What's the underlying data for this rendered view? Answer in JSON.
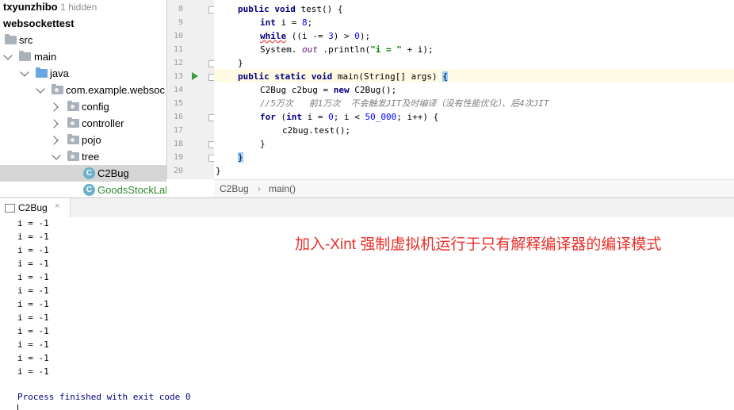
{
  "project_tree": {
    "items": [
      {
        "label": "txyunzhibo",
        "extra": "1 hidden"
      },
      {
        "label": "websockettest"
      },
      {
        "label": "src"
      },
      {
        "label": "main"
      },
      {
        "label": "java"
      },
      {
        "label": "com.example.websoc"
      },
      {
        "label": "config"
      },
      {
        "label": "controller"
      },
      {
        "label": "pojo"
      },
      {
        "label": "tree"
      },
      {
        "label": "C2Bug"
      },
      {
        "label": "GoodsStockLab"
      }
    ],
    "class_icon_letter": "C"
  },
  "editor": {
    "line_numbers": [
      "8",
      "9",
      "10",
      "11",
      "12",
      "13",
      "14",
      "15",
      "16",
      "17",
      "18",
      "19",
      "20"
    ],
    "lines": [
      {
        "t": [
          {
            "c": "kw",
            "s": "public void "
          },
          {
            "c": "",
            "s": "test() {"
          }
        ]
      },
      {
        "t": [
          {
            "c": "kw",
            "s": "int "
          },
          {
            "c": "",
            "s": "i = "
          },
          {
            "c": "num",
            "s": "8"
          },
          {
            "c": "",
            "s": ";"
          }
        ]
      },
      {
        "t": [
          {
            "c": "kw",
            "s": "while"
          },
          {
            "c": "",
            "s": " ((i -= "
          },
          {
            "c": "num",
            "s": "3"
          },
          {
            "c": "",
            "s": ") > "
          },
          {
            "c": "num",
            "s": "0"
          },
          {
            "c": "",
            "s": ");"
          }
        ]
      },
      {
        "t": [
          {
            "c": "",
            "s": "System. "
          },
          {
            "c": "fld",
            "s": "out"
          },
          {
            "c": "",
            "s": " .println("
          },
          {
            "c": "str",
            "s": "\"i = \""
          },
          {
            "c": "",
            "s": " + i);"
          }
        ]
      },
      {
        "t": [
          {
            "c": "",
            "s": "}"
          }
        ]
      },
      {
        "t": [
          {
            "c": "kw",
            "s": "public static void "
          },
          {
            "c": "",
            "s": "main(String[] args) "
          },
          {
            "c": "brace",
            "s": "{"
          }
        ]
      },
      {
        "t": [
          {
            "c": "",
            "s": "C2Bug c2bug = "
          },
          {
            "c": "kw",
            "s": "new "
          },
          {
            "c": "",
            "s": "C2Bug();"
          }
        ]
      },
      {
        "t": [
          {
            "c": "cmt",
            "s": "//5万次   前1万次  不会触发JIT及时编译（没有性能优化）、后4次JIT"
          }
        ]
      },
      {
        "t": [
          {
            "c": "kw",
            "s": "for "
          },
          {
            "c": "",
            "s": "("
          },
          {
            "c": "kw",
            "s": "int "
          },
          {
            "c": "",
            "s": "i = "
          },
          {
            "c": "num",
            "s": "0"
          },
          {
            "c": "",
            "s": "; i < "
          },
          {
            "c": "num",
            "s": "50_000"
          },
          {
            "c": "",
            "s": "; i++) {"
          }
        ]
      },
      {
        "t": [
          {
            "c": "",
            "s": "c2bug.test();"
          }
        ]
      },
      {
        "t": [
          {
            "c": "",
            "s": "}"
          }
        ]
      },
      {
        "t": [
          {
            "c": "brace",
            "s": "}"
          }
        ]
      },
      {
        "t": [
          {
            "c": "",
            "s": "}"
          }
        ]
      }
    ],
    "breadcrumb": {
      "class": "C2Bug",
      "sep": "›",
      "method": "main()"
    }
  },
  "run_panel": {
    "tab_label": "C2Bug",
    "tab_close": "×",
    "output_lines": [
      "i = -1",
      "i = -1",
      "i = -1",
      "i = -1",
      "i = -1",
      "i = -1",
      "i = -1",
      "i = -1",
      "i = -1",
      "i = -1",
      "i = -1",
      "i = -1"
    ],
    "exit_message": "Process finished with exit code 0",
    "annotation": "加入-Xint 强制虚拟机运行于只有解释编译器的编译模式"
  },
  "colors": {
    "annotation": "#e8302a",
    "keyword": "#000080",
    "string": "#008000",
    "number": "#0000ff",
    "selection": "#d5d5d5"
  }
}
